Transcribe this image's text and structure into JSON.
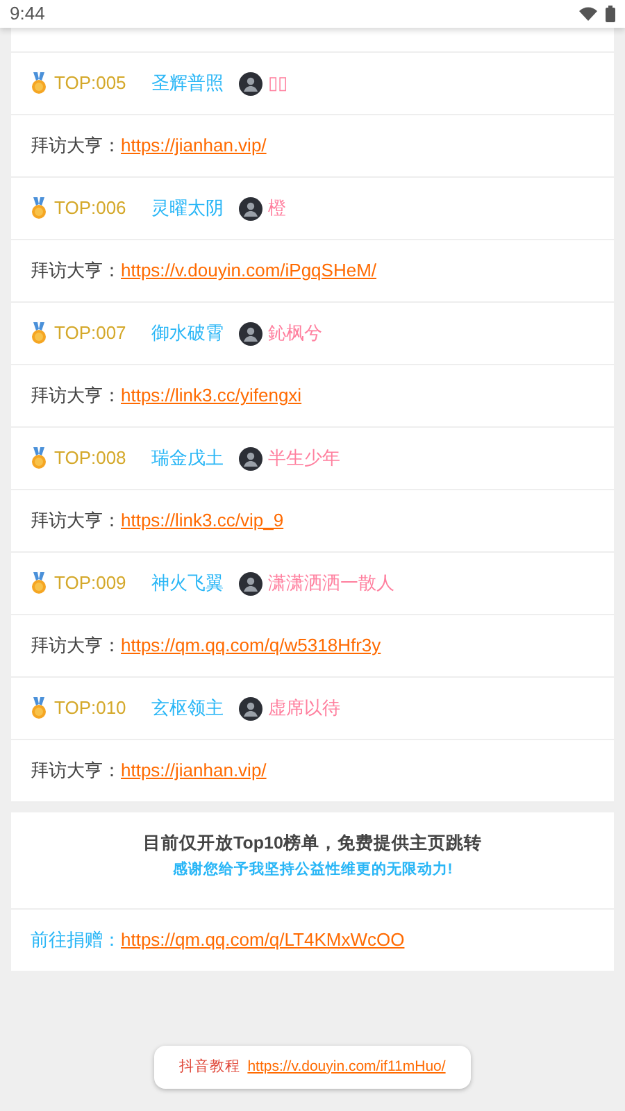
{
  "status_bar": {
    "time": "9:44"
  },
  "entries": [
    {
      "rank": "TOP:005",
      "title": "圣辉普照",
      "nickname": "▯▯",
      "visit_label": "拜访大亨：",
      "url": "https://jianhan.vip/"
    },
    {
      "rank": "TOP:006",
      "title": "灵曜太阴",
      "nickname": "橙",
      "visit_label": "拜访大亨：",
      "url": "https://v.douyin.com/iPgqSHeM/"
    },
    {
      "rank": "TOP:007",
      "title": "御水破霄",
      "nickname": "鈊枫兮",
      "visit_label": "拜访大亨：",
      "url": "https://link3.cc/yifengxi"
    },
    {
      "rank": "TOP:008",
      "title": "瑞金戊土",
      "nickname": "半生少年",
      "visit_label": "拜访大亨：",
      "url": "https://link3.cc/vip_9"
    },
    {
      "rank": "TOP:009",
      "title": "神火飞翼",
      "nickname": "潇潇洒洒一散人",
      "visit_label": "拜访大亨：",
      "url": "https://qm.qq.com/q/w5318Hfr3y"
    },
    {
      "rank": "TOP:010",
      "title": "玄枢领主",
      "nickname": "虚席以待",
      "visit_label": "拜访大亨：",
      "url": "https://jianhan.vip/"
    }
  ],
  "notice": {
    "headline": "目前仅开放Top10榜单，免费提供主页跳转",
    "subline": "感谢您给予我坚持公益性维更的无限动力!",
    "donate_label": "前往捐赠：",
    "donate_url": "https://qm.qq.com/q/LT4KMxWcOO"
  },
  "footer": {
    "label": "抖音教程",
    "url": "https://v.douyin.com/if11mHuo/"
  }
}
